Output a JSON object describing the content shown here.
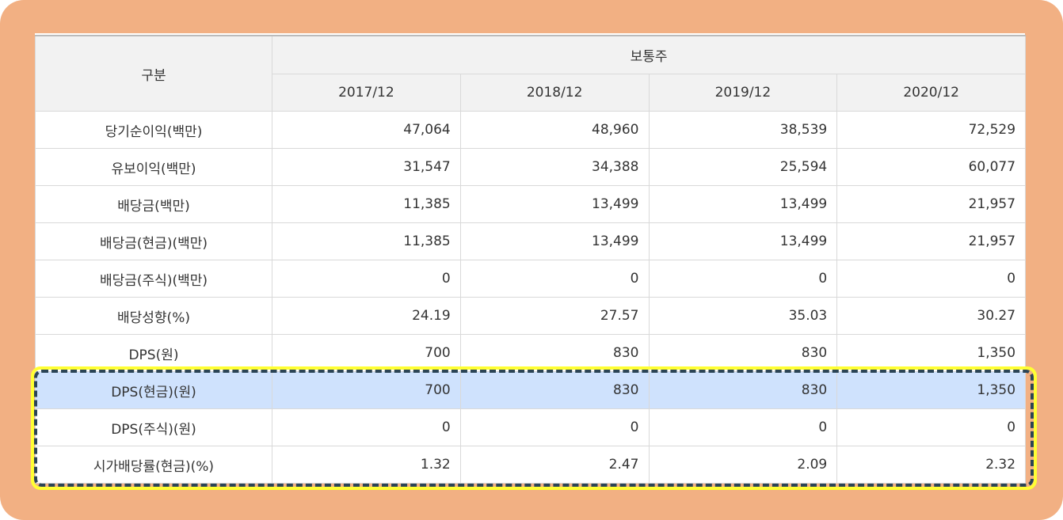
{
  "table": {
    "header_label": "구분",
    "group_label": "보통주",
    "years": [
      "2017/12",
      "2018/12",
      "2019/12",
      "2020/12"
    ],
    "rows": [
      {
        "label": "당기순이익(백만)",
        "values": [
          "47,064",
          "48,960",
          "38,539",
          "72,529"
        ]
      },
      {
        "label": "유보이익(백만)",
        "values": [
          "31,547",
          "34,388",
          "25,594",
          "60,077"
        ]
      },
      {
        "label": "배당금(백만)",
        "values": [
          "11,385",
          "13,499",
          "13,499",
          "21,957"
        ]
      },
      {
        "label": "배당금(현금)(백만)",
        "values": [
          "11,385",
          "13,499",
          "13,499",
          "21,957"
        ]
      },
      {
        "label": "배당금(주식)(백만)",
        "values": [
          "0",
          "0",
          "0",
          "0"
        ]
      },
      {
        "label": "배당성향(%)",
        "values": [
          "24.19",
          "27.57",
          "35.03",
          "30.27"
        ]
      },
      {
        "label": "DPS(원)",
        "values": [
          "700",
          "830",
          "830",
          "1,350"
        ]
      },
      {
        "label": "DPS(현금)(원)",
        "values": [
          "700",
          "830",
          "830",
          "1,350"
        ]
      },
      {
        "label": "DPS(주식)(원)",
        "values": [
          "0",
          "0",
          "0",
          "0"
        ]
      },
      {
        "label": "시가배당률(현금)(%)",
        "values": [
          "1.32",
          "2.47",
          "2.09",
          "2.32"
        ]
      }
    ],
    "selected_row_index": 7,
    "highlighted_rows": [
      7,
      8,
      9
    ]
  },
  "colors": {
    "frame": "#f2b083",
    "header_bg": "#f2f2f2",
    "selected_row_bg": "#cfe2fd",
    "highlight_outer": "#ffff33",
    "highlight_dash": "#2b4456"
  }
}
